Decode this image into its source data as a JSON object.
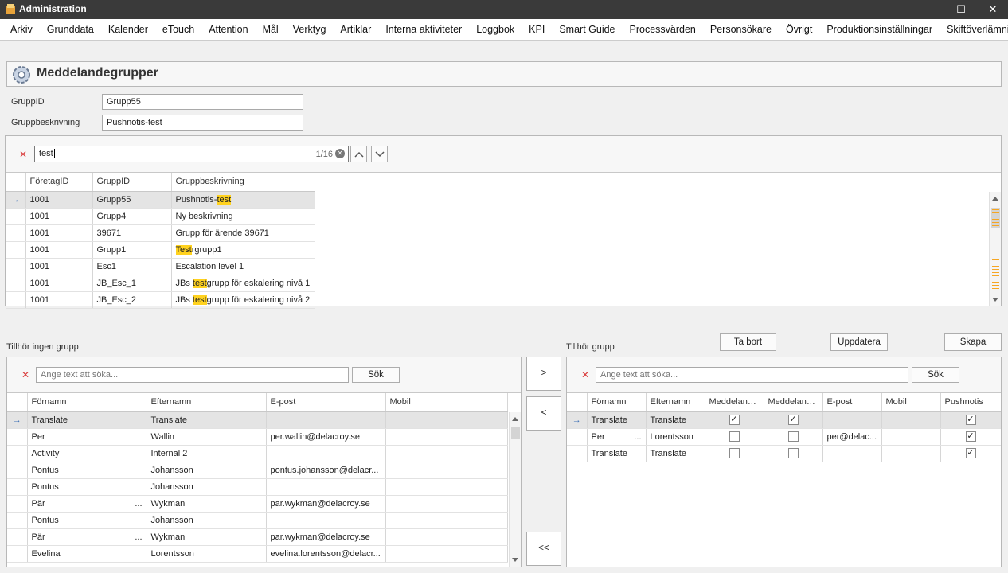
{
  "window": {
    "title": "Administration",
    "minimize": "—",
    "maximize": "☐",
    "close": "✕"
  },
  "menu": [
    "Arkiv",
    "Grunddata",
    "Kalender",
    "eTouch",
    "Attention",
    "Mål",
    "Verktyg",
    "Artiklar",
    "Interna aktiviteter",
    "Loggbok",
    "KPI",
    "Smart Guide",
    "Processvärden",
    "Personsökare",
    "Övrigt",
    "Produktionsinställningar",
    "Skiftöverlämning"
  ],
  "header": {
    "title": "Meddelandegrupper"
  },
  "form": {
    "gruppid_label": "GruppID",
    "gruppid_value": "Grupp55",
    "desc_label": "Gruppbeskrivning",
    "desc_value": "Pushnotis-test"
  },
  "search": {
    "value": "test",
    "counter": "1/16",
    "clear_icon": "✕",
    "up_icon": "chevron-up-icon",
    "down_icon": "chevron-down-icon"
  },
  "groups": {
    "columns": [
      "FöretagID",
      "GruppID",
      "Gruppbeskrivning"
    ],
    "rows": [
      {
        "f": "1001",
        "g": "Grupp55",
        "pre": "Pushnotis-",
        "hl": "test",
        "post": ""
      },
      {
        "f": "1001",
        "g": "Grupp4",
        "pre": "Ny beskrivning",
        "hl": "",
        "post": ""
      },
      {
        "f": "1001",
        "g": "39671",
        "pre": "Grupp för ärende 39671",
        "hl": "",
        "post": ""
      },
      {
        "f": "1001",
        "g": "Grupp1",
        "pre": "",
        "hl": "Test",
        "post": "rgrupp1"
      },
      {
        "f": "1001",
        "g": "Esc1",
        "pre": "Escalation level 1",
        "hl": "",
        "post": ""
      },
      {
        "f": "1001",
        "g": "JB_Esc_1",
        "pre": "JBs ",
        "hl": "test",
        "post": "grupp för eskalering nivå 1"
      },
      {
        "f": "1001",
        "g": "JB_Esc_2",
        "pre": "JBs ",
        "hl": "test",
        "post": "grupp för eskalering nivå 2"
      }
    ]
  },
  "left": {
    "title": "Tillhör ingen grupp",
    "search_placeholder": "Ange text att söka...",
    "search_button": "Sök",
    "columns": [
      "Förnamn",
      "Efternamn",
      "E-post",
      "Mobil"
    ],
    "rows": [
      [
        "Translate",
        "",
        "Translate",
        "",
        ""
      ],
      [
        "Per",
        "",
        "Wallin",
        "per.wallin@delacroy.se",
        ""
      ],
      [
        "Activity",
        "",
        "Internal 2",
        "",
        ""
      ],
      [
        "Pontus",
        "",
        "Johansson",
        "pontus.johansson@delacr...",
        ""
      ],
      [
        "Pontus",
        "",
        "Johansson",
        "",
        ""
      ],
      [
        "Pär",
        "...",
        "Wykman",
        "par.wykman@delacroy.se",
        ""
      ],
      [
        "Pontus",
        "",
        "Johansson",
        "",
        ""
      ],
      [
        "Pär",
        "...",
        "Wykman",
        "par.wykman@delacroy.se",
        ""
      ],
      [
        "Evelina",
        "",
        "Lorentsson",
        "evelina.lorentsson@delacr...",
        ""
      ]
    ]
  },
  "move_buttons": {
    "add": ">",
    "remove": "<",
    "remove_all": "<<"
  },
  "right": {
    "title": "Tillhör grupp",
    "delete_button": "Ta bort",
    "update_button": "Uppdatera",
    "create_button": "Skapa",
    "search_placeholder": "Ange text att söka...",
    "search_button": "Sök",
    "columns": [
      "Förnamn",
      "Efternamn",
      "Meddeland...",
      "Meddeland...",
      "E-post",
      "Mobil",
      "Pushnotis"
    ],
    "rows": [
      {
        "fn": "Translate",
        "dots": "",
        "en": "Translate",
        "m1": true,
        "m2": true,
        "mail": "",
        "mob": "",
        "push": true
      },
      {
        "fn": "Per",
        "dots": "...",
        "en": "Lorentsson",
        "m1": false,
        "m2": false,
        "mail": "per@delac...",
        "mob": "",
        "push": true
      },
      {
        "fn": "Translate",
        "dots": "",
        "en": "Translate",
        "m1": false,
        "m2": false,
        "mail": "",
        "mob": "",
        "push": true
      }
    ]
  },
  "colors": {
    "titlebar": "#3a3a3a",
    "highlight": "#ffd21f",
    "row_indicator": "#3b6fb6",
    "clear_x": "#d93a3a"
  }
}
